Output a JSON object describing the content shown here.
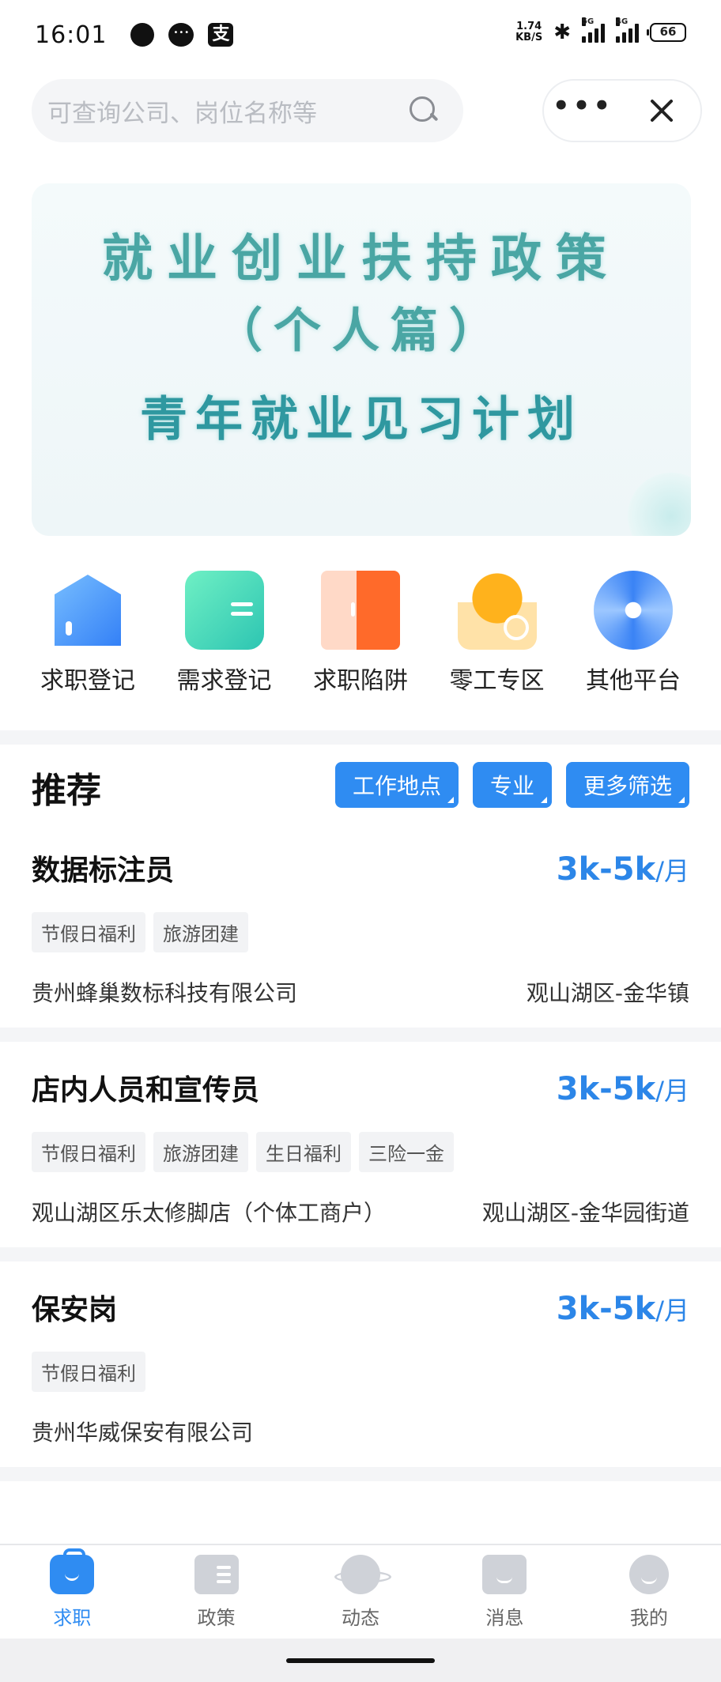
{
  "status_bar": {
    "time": "16:01",
    "net_speed_value": "1.74",
    "net_speed_unit": "KB/S",
    "sig1": "5G",
    "sig2": "4G",
    "battery": "66"
  },
  "search": {
    "placeholder": "可查询公司、岗位名称等"
  },
  "banner": {
    "line1": "就业创业扶持政策",
    "line2": "（个人篇）",
    "line3": "青年就业见习计划"
  },
  "quick_entries": [
    {
      "label": "求职登记",
      "icon": "house-icon"
    },
    {
      "label": "需求登记",
      "icon": "folder-icon"
    },
    {
      "label": "求职陷阱",
      "icon": "door-icon"
    },
    {
      "label": "零工专区",
      "icon": "sun-icon"
    },
    {
      "label": "其他平台",
      "icon": "gear-icon"
    }
  ],
  "recommend": {
    "title": "推荐",
    "filters": [
      "工作地点",
      "专业",
      "更多筛选"
    ]
  },
  "jobs": [
    {
      "title": "数据标注员",
      "salary": "3k-5k",
      "unit": "/月",
      "tags": [
        "节假日福利",
        "旅游团建"
      ],
      "company": "贵州蜂巢数标科技有限公司",
      "location": "观山湖区-金华镇"
    },
    {
      "title": "店内人员和宣传员",
      "salary": "3k-5k",
      "unit": "/月",
      "tags": [
        "节假日福利",
        "旅游团建",
        "生日福利",
        "三险一金"
      ],
      "company": "观山湖区乐太修脚店（个体工商户）",
      "location": "观山湖区-金华园街道"
    },
    {
      "title": "保安岗",
      "salary": "3k-5k",
      "unit": "/月",
      "tags": [
        "节假日福利"
      ],
      "company": "贵州华威保安有限公司",
      "location": ""
    }
  ],
  "tabbar": [
    {
      "label": "求职",
      "active": true
    },
    {
      "label": "政策",
      "active": false
    },
    {
      "label": "动态",
      "active": false
    },
    {
      "label": "消息",
      "active": false
    },
    {
      "label": "我的",
      "active": false
    }
  ],
  "colors": {
    "accent": "#2f8cf2",
    "salary": "#2c86e8",
    "banner_text": "#3da7a7"
  }
}
